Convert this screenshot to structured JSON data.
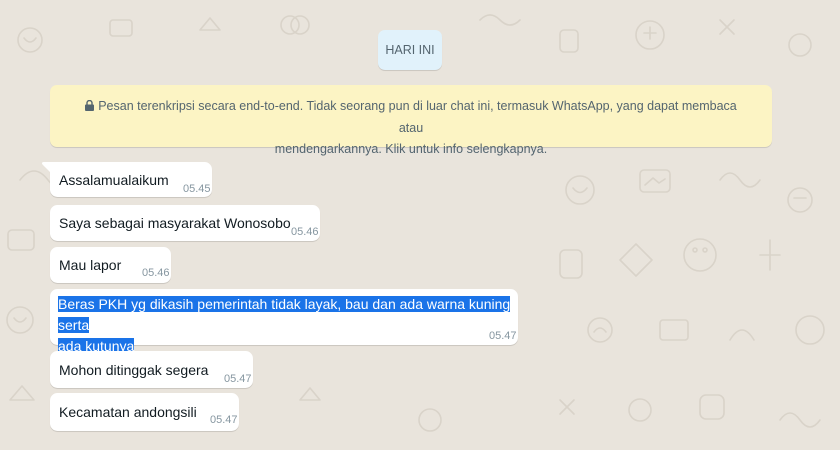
{
  "date_divider": "HARI INI",
  "encryption_notice": {
    "line1": "Pesan terenkripsi secara end-to-end. Tidak seorang pun di luar chat ini, termasuk WhatsApp, yang dapat membaca atau",
    "line2": "mendengarkannya. Klik untuk info selengkapnya."
  },
  "messages": [
    {
      "text": "Assalamualaikum",
      "time": "05.45"
    },
    {
      "text": "Saya sebagai masyarakat Wonosobo",
      "time": "05.46"
    },
    {
      "text": "Mau lapor",
      "time": "05.46"
    },
    {
      "text_line1": "Beras PKH yg dikasih pemerintah tidak layak, bau dan ada warna kuning serta",
      "text_line2": "ada kutunya",
      "time": "05.47",
      "selected": true
    },
    {
      "text": "Mohon ditinggak segera",
      "time": "05.47"
    },
    {
      "text": "Kecamatan andongsili",
      "time": "05.47"
    }
  ],
  "colors": {
    "background": "#e9e4dc",
    "bubble": "#ffffff",
    "encryption_bg": "#fcf4c4",
    "date_chip_bg": "#e1f2fb",
    "selection": "#1a73e8"
  }
}
